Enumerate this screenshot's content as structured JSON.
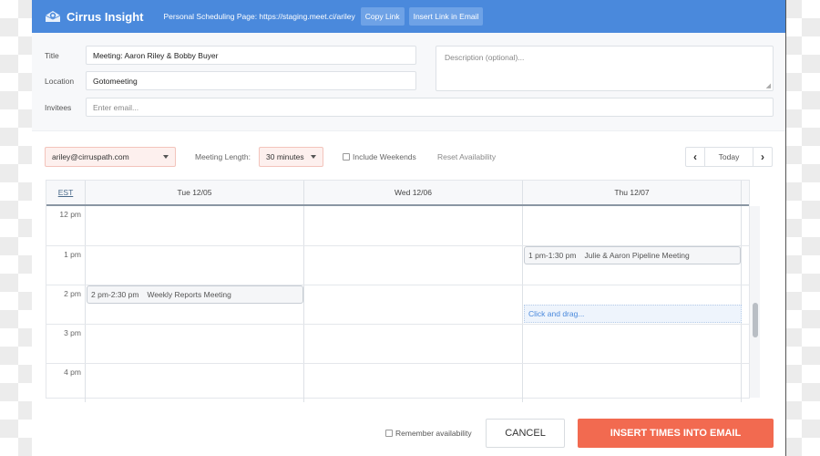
{
  "header": {
    "app_name": "Cirrus Insight",
    "logo_icon": "envelope-cloud-icon",
    "scheduling_label": "Personal Scheduling Page: https://staging.meet.ci/ariley",
    "copy_link": "Copy Link",
    "insert_link": "Insert Link in Email"
  },
  "form": {
    "title_label": "Title",
    "title_value": "Meeting: Aaron Riley & Bobby Buyer",
    "location_label": "Location",
    "location_value": "Gotomeeting",
    "invitees_label": "Invitees",
    "invitees_placeholder": "Enter email...",
    "description_placeholder": "Description (optional)..."
  },
  "toolbar": {
    "calendar_account": "ariley@cirruspath.com",
    "meeting_length_label": "Meeting Length:",
    "meeting_length_value": "30 minutes",
    "include_weekends_label": "Include Weekends",
    "include_weekends_checked": false,
    "reset_availability": "Reset Availability",
    "prev_icon": "chevron-left-icon",
    "today_label": "Today",
    "next_icon": "chevron-right-icon"
  },
  "calendar": {
    "timezone": "EST",
    "days": [
      "Tue 12/05",
      "Wed 12/06",
      "Thu 12/07"
    ],
    "hours": [
      "12 pm",
      "1 pm",
      "2 pm",
      "3 pm",
      "4 pm"
    ],
    "events": [
      {
        "day": 2,
        "time": "1 pm-1:30 pm",
        "title": "Julie & Aaron Pipeline Meeting"
      },
      {
        "day": 0,
        "time": "2 pm-2:30 pm",
        "title": "Weekly Reports Meeting"
      }
    ],
    "drag_hint": "Click and drag..."
  },
  "footer": {
    "remember_label": "Remember availability",
    "remember_checked": false,
    "cancel": "CANCEL",
    "insert": "INSERT TIMES INTO EMAIL"
  }
}
